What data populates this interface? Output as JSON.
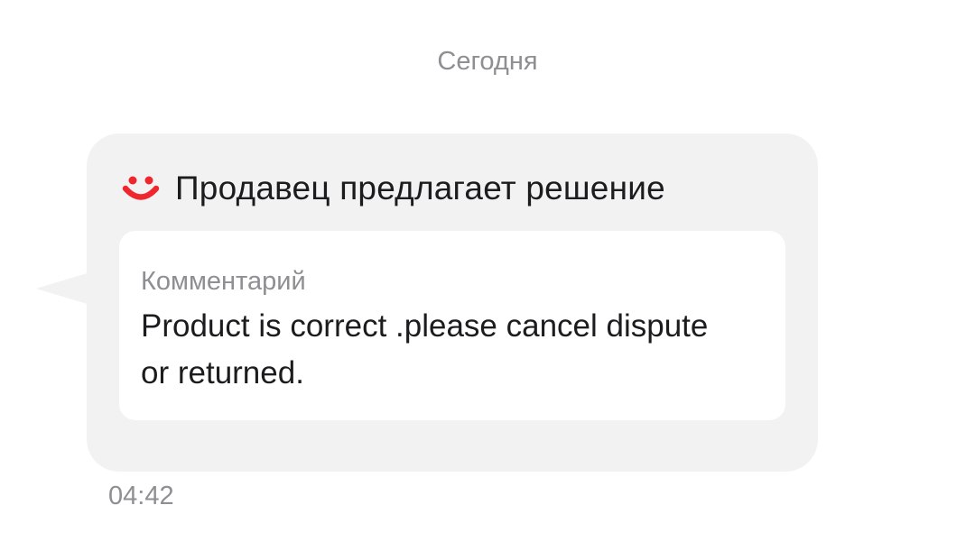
{
  "date_separator": "Сегодня",
  "message": {
    "header_icon": "smile-icon",
    "header_text": "Продавец предлагает решение",
    "comment_label": "Комментарий",
    "comment_text": "Product is correct .please cancel dispute or returned.",
    "time": "04:42"
  },
  "colors": {
    "accent": "#f0262e",
    "bubble": "#f2f2f2",
    "card": "#ffffff",
    "secondary_text": "#8e8e93",
    "primary_text": "#1c1c1e"
  }
}
